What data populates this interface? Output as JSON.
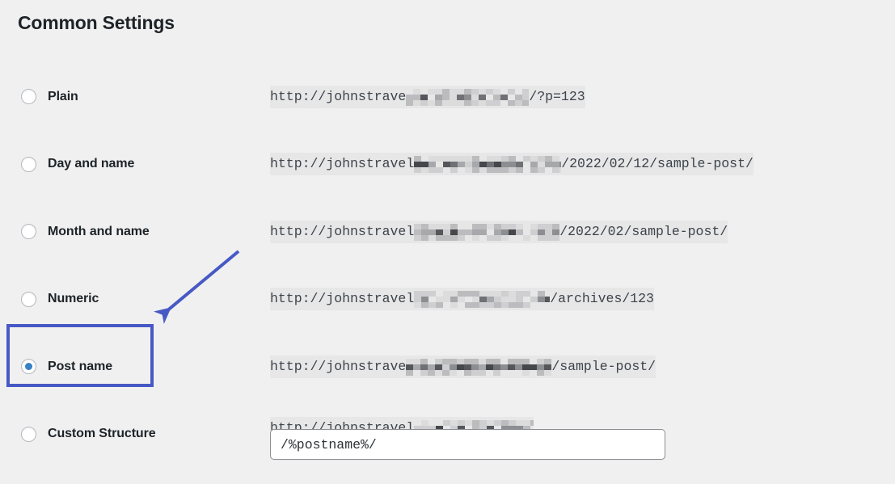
{
  "page": {
    "title": "Common Settings",
    "accent_blue": "#4759c4",
    "radio_selected_color": "#3582c4",
    "background": "#f0f0f1",
    "code_background": "#e7e7e8"
  },
  "options": [
    {
      "id": "plain",
      "label": "Plain",
      "selected": false,
      "url": {
        "prefix": "http://johnstrave",
        "redacted": true,
        "redacted_width": 152,
        "suffix": "/?p=123"
      }
    },
    {
      "id": "day-and-name",
      "label": "Day and name",
      "selected": false,
      "url": {
        "prefix": "http://johnstravel",
        "redacted": true,
        "redacted_width": 182,
        "suffix": "/2022/02/12/sample-post/"
      }
    },
    {
      "id": "month-and-name",
      "label": "Month and name",
      "selected": false,
      "url": {
        "prefix": "http://johnstravel",
        "redacted": true,
        "redacted_width": 180,
        "suffix": "/2022/02/sample-post/"
      }
    },
    {
      "id": "numeric",
      "label": "Numeric",
      "selected": false,
      "url": {
        "prefix": "http://johnstravel",
        "redacted": true,
        "redacted_width": 168,
        "suffix": "/archives/123"
      }
    },
    {
      "id": "post-name",
      "label": "Post name",
      "selected": true,
      "url": {
        "prefix": "http://johnstrave",
        "redacted": true,
        "redacted_width": 180,
        "suffix": "/sample-post/"
      }
    },
    {
      "id": "custom-structure",
      "label": "Custom Structure",
      "selected": false,
      "url": {
        "prefix": "http://johnstravel",
        "redacted": true,
        "redacted_width": 148,
        "suffix": ""
      }
    }
  ],
  "custom_structure_field": {
    "value": "/%postname%/",
    "placeholder": "/%postname%/"
  },
  "annotation": {
    "arrow": "arrow-pointing-to-post-name",
    "color": "#4759c4",
    "highlight_target": "post-name"
  }
}
